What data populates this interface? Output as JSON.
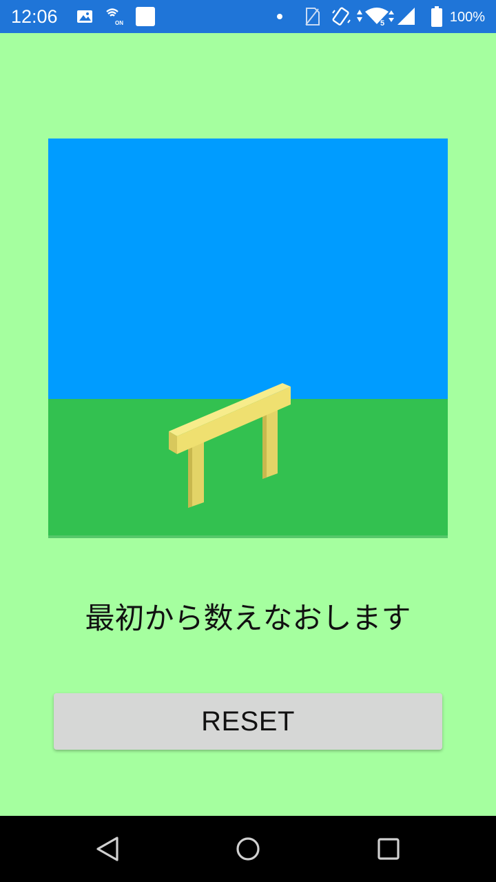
{
  "status_bar": {
    "time": "12:06",
    "battery": "100%",
    "background_color": "#1f75d8",
    "icons": [
      "image-icon",
      "nfc-on-icon",
      "square-notification-icon",
      "dot-icon",
      "no-sim-icon",
      "vibrate-icon",
      "wifi-data-icon",
      "signal-icon",
      "battery-icon"
    ]
  },
  "scene": {
    "sky_color": "#009cff",
    "ground_color": "#33c150",
    "hurdle_color": "#efe070"
  },
  "main": {
    "message": "最初から数えなおします",
    "reset_label": "RESET",
    "background_color": "#a5ff9f"
  },
  "nav_bar": {
    "items": [
      "back-icon",
      "home-icon",
      "recents-icon"
    ]
  }
}
